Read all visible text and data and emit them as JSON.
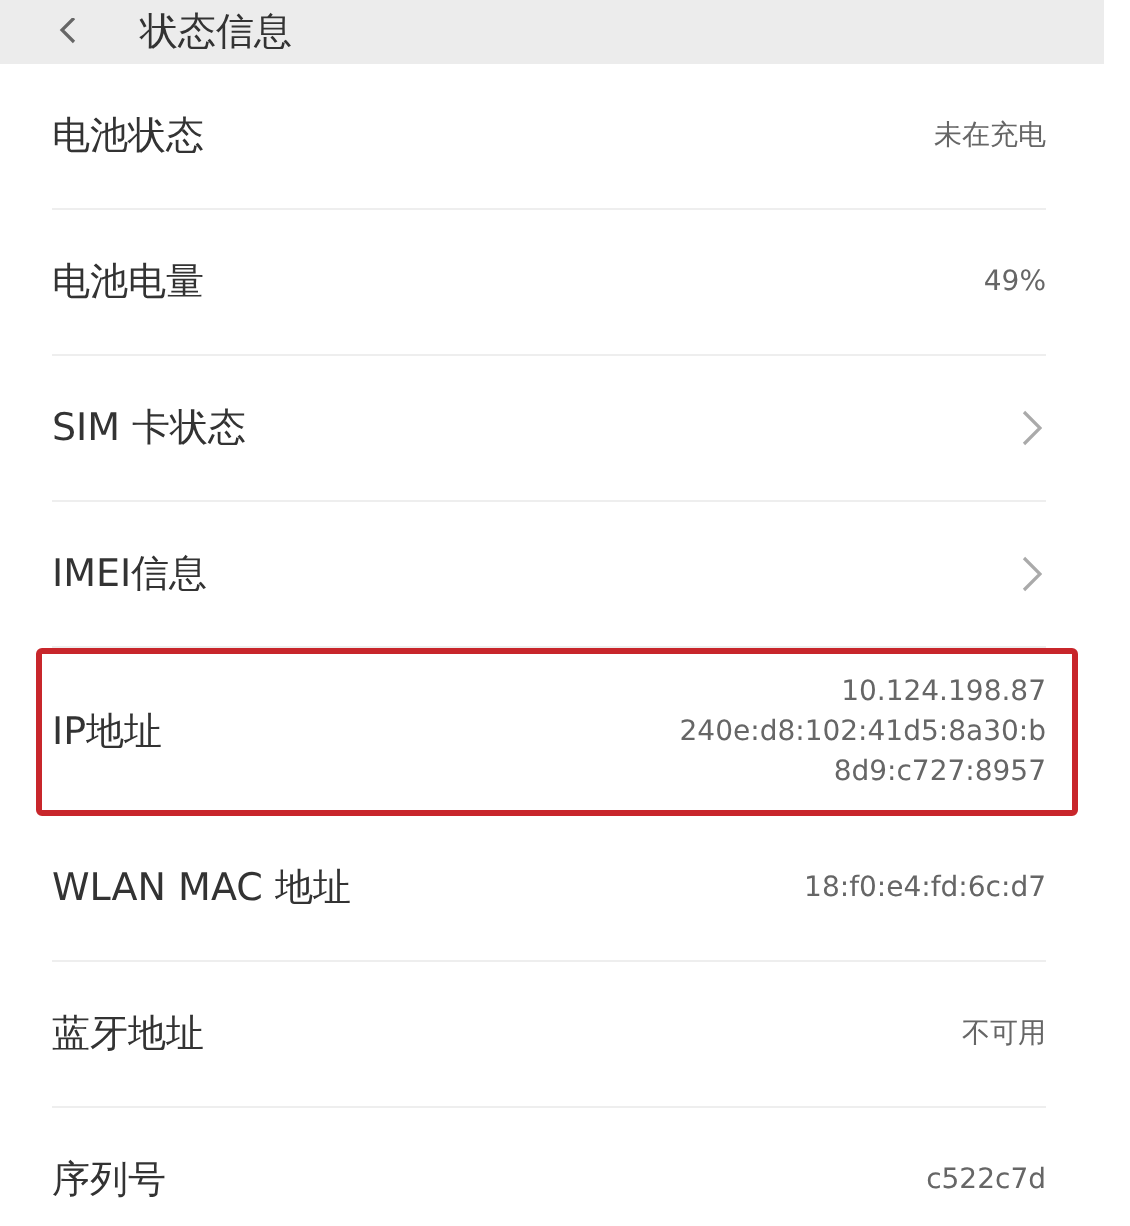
{
  "header": {
    "title": "状态信息"
  },
  "rows": [
    {
      "label": "电池状态",
      "kind": "value",
      "lines": [
        "未在充电"
      ],
      "highlighted": false
    },
    {
      "label": "电池电量",
      "kind": "value",
      "lines": [
        "49%"
      ],
      "highlighted": false
    },
    {
      "label": "SIM 卡状态",
      "kind": "link",
      "highlighted": false
    },
    {
      "label": "IMEI信息",
      "kind": "link",
      "highlighted": false
    },
    {
      "label": "IP地址",
      "kind": "value",
      "lines": [
        "10.124.198.87",
        "240e:d8:102:41d5:8a30:b",
        "8d9:c727:8957"
      ],
      "highlighted": true
    },
    {
      "label": "WLAN MAC 地址",
      "kind": "value",
      "lines": [
        "18:f0:e4:fd:6c:d7"
      ],
      "highlighted": false
    },
    {
      "label": "蓝牙地址",
      "kind": "value",
      "lines": [
        "不可用"
      ],
      "highlighted": false
    },
    {
      "label": "序列号",
      "kind": "value",
      "lines": [
        "c522c7d"
      ],
      "highlighted": false
    }
  ]
}
